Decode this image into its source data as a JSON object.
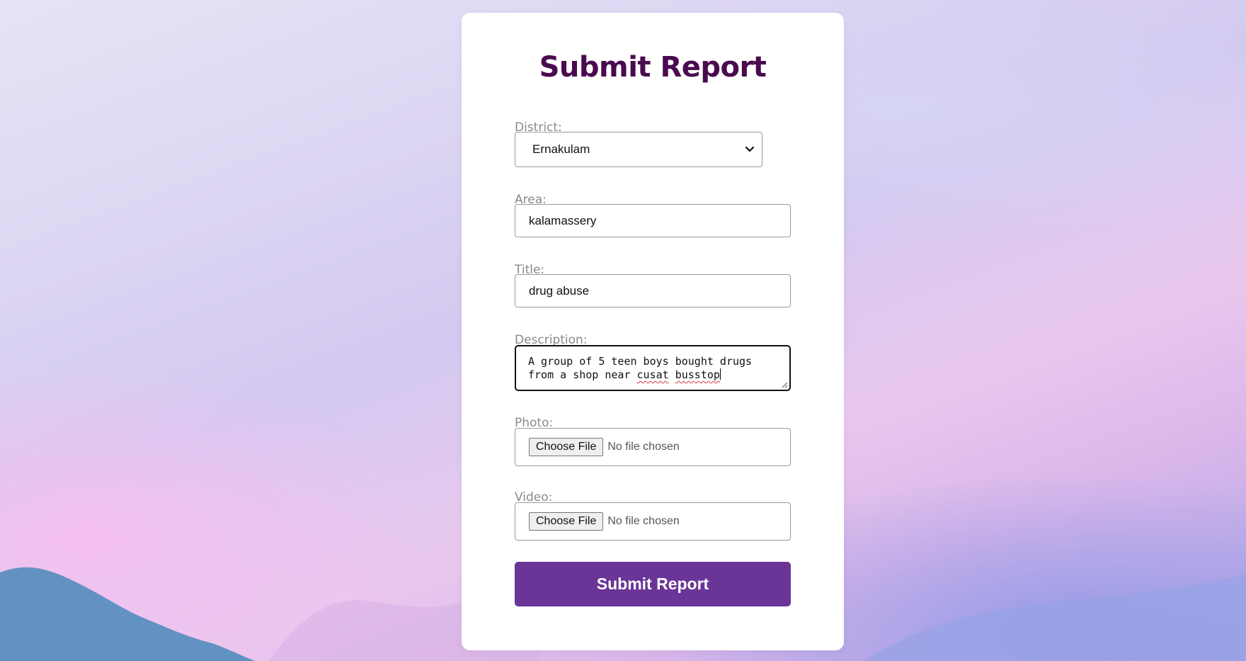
{
  "form": {
    "heading": "Submit Report",
    "district": {
      "label": "District:",
      "value": "Ernakulam"
    },
    "area": {
      "label": "Area:",
      "value": "kalamassery"
    },
    "title": {
      "label": "Title:",
      "value": "drug abuse"
    },
    "description": {
      "label": "Description:",
      "line1": "A group of 5 teen boys bought drugs",
      "line2_prefix": "from a shop near ",
      "line2_word1": "cusat",
      "line2_word2": "busstop"
    },
    "photo": {
      "label": "Photo:",
      "button_label": "Choose File",
      "status": "No file chosen"
    },
    "video": {
      "label": "Video:",
      "button_label": "Choose File",
      "status": "No file chosen"
    },
    "submit_label": "Submit Report"
  },
  "colors": {
    "heading": "#4a0a4f",
    "submit_button": "#6a3597",
    "label": "#8a8a8a"
  },
  "icons": {
    "select_arrow": "chevron-down-icon",
    "textarea_resize": "resize-handle-icon"
  }
}
